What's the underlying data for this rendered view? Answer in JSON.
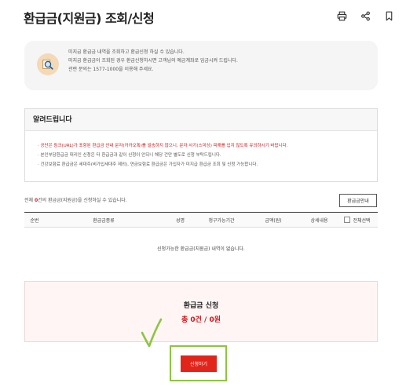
{
  "page": {
    "title": "환급금(지원금) 조회/신청"
  },
  "icons": {
    "print": "print-icon",
    "share": "share-icon",
    "bookmark": "bookmark-icon",
    "search_money": "search-money-icon"
  },
  "info": {
    "lines": [
      "미지급 환급금 내역을 조회하고 환급신청 하실 수 있습니다.",
      "미지급 환급금이 조회된 경우 환급신청하시면 고객님의 예금계좌로 입금시켜 드립니다.",
      "관련 문의는 1577-1000을 이용해 주세요."
    ]
  },
  "notice": {
    "heading": "알려드립니다",
    "items": [
      {
        "text": "공단은 링크(URL)가 포함된 환급금 안내 문자(카카오톡)를 발송하지 않으니, 문자 사기(스미싱) 피해를 입지 않도록 유의하시기 바랍니다.",
        "highlight": true
      },
      {
        "text": "본인부담환급금 대리인 신청은 타 환급금과 같이 신청이 안되니 해당 건만 별도로 신청 부탁드립니다.",
        "highlight": false
      },
      {
        "text": "건강보험료 환급금은 세대주(비가입세대주 제외), 연금보험료 환급금은 가입자가 미지급 환급금 조회 및 신청 가능합니다.",
        "highlight": false
      }
    ]
  },
  "summary": {
    "prefix": "전체 ",
    "count": "0",
    "suffix": "건의 환급금(지원금)을 신청하실 수 있습니다."
  },
  "guide_button": "환급금안내",
  "table": {
    "headers": [
      "순번",
      "환급금종류",
      "성명",
      "청구가능기간",
      "금액(원)",
      "상세내용",
      "전체선택"
    ],
    "empty_message": "신청가능한 환급금(지원금) 내역이 없습니다."
  },
  "apply": {
    "title": "환급금 신청",
    "total": "총 0건 / 0원",
    "button": "신청하기"
  },
  "colors": {
    "accent": "#e1251b",
    "highlight_outline": "#8cc63f",
    "info_bg": "#f5f5f5",
    "apply_bg": "#fff5f5"
  }
}
